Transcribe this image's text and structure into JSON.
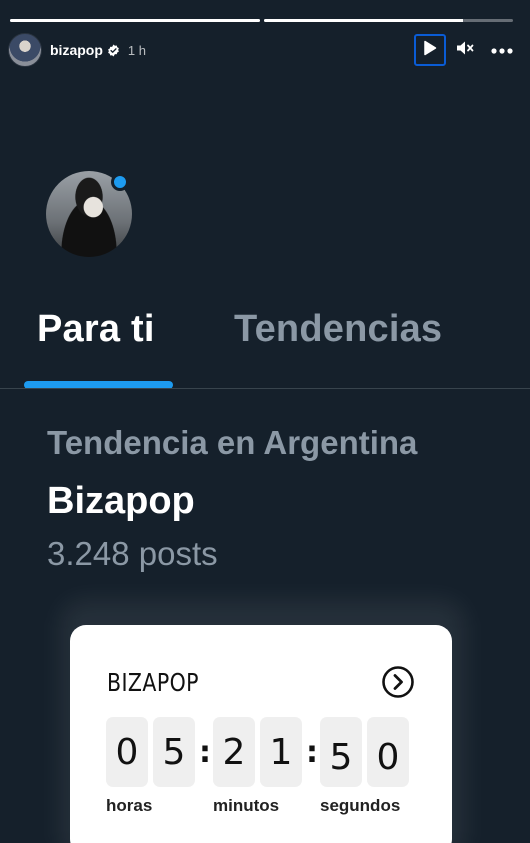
{
  "story": {
    "progress": [
      1.0,
      0.8
    ],
    "username": "bizapop",
    "verified": true,
    "timestamp": "1 h",
    "controls": {
      "play_icon": "play-icon",
      "mute_icon": "speaker-muted-icon",
      "more_icon": "more-horizontal-icon"
    }
  },
  "profile": {
    "online": true,
    "online_color": "#1d9bf0"
  },
  "tabs": [
    {
      "label": "Para ti",
      "active": true
    },
    {
      "label": "Tendencias",
      "active": false
    }
  ],
  "trend": {
    "context": "Tendencia en Argentina",
    "name": "Bizapop",
    "count": "3.248 posts"
  },
  "countdown": {
    "title": "BIZAPOP",
    "arrow_icon": "chevron-right-circle-icon",
    "digits": {
      "hours": [
        "0",
        "5"
      ],
      "minutes": [
        "2",
        "1"
      ],
      "seconds": [
        "5",
        "0"
      ]
    },
    "labels": {
      "hours": "horas",
      "minutes": "minutos",
      "seconds": "segundos"
    }
  },
  "colors": {
    "background": "#15202b",
    "accent": "#1d9bf0",
    "muted_text": "#8b98a5"
  }
}
